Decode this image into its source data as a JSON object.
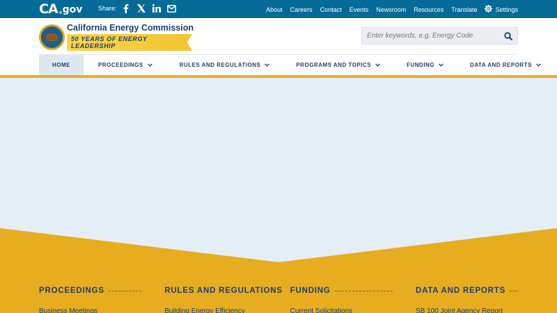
{
  "utility": {
    "logo_ca": "CA",
    "logo_gov": "gov",
    "share_label": "Share:",
    "share_icons": [
      "facebook-icon",
      "x-icon",
      "linkedin-icon",
      "email-icon"
    ],
    "links": [
      "About",
      "Careers",
      "Contact",
      "Events",
      "Newsroom",
      "Resources",
      "Translate"
    ],
    "settings_label": "Settings"
  },
  "branding": {
    "title": "California Energy Commission",
    "tagline": "50 YEARS OF ENERGY LEADERSHIP",
    "search_placeholder": "Enter keywords, e.g. Energy Code"
  },
  "nav": {
    "items": [
      {
        "label": "HOME",
        "dropdown": false
      },
      {
        "label": "PROCEEDINGS",
        "dropdown": true
      },
      {
        "label": "RULES AND REGULATIONS",
        "dropdown": true
      },
      {
        "label": "PROGRAMS AND TOPICS",
        "dropdown": true
      },
      {
        "label": "FUNDING",
        "dropdown": true
      },
      {
        "label": "DATA AND REPORTS",
        "dropdown": true
      }
    ]
  },
  "footer": {
    "columns": [
      {
        "heading": "PROCEEDINGS",
        "first_link": "Business Meetings"
      },
      {
        "heading": "RULES AND REGULATIONS",
        "first_link": "Building Energy Efficiency"
      },
      {
        "heading": "FUNDING",
        "first_link": "Current Solicitations"
      },
      {
        "heading": "DATA AND REPORTS",
        "first_link": "SB 100 Joint Agency Report"
      }
    ]
  },
  "colors": {
    "utility_bg": "#046b99",
    "navy": "#1c3f6e",
    "gold": "#e7ad1f",
    "hero_bg": "#e4eef6"
  }
}
